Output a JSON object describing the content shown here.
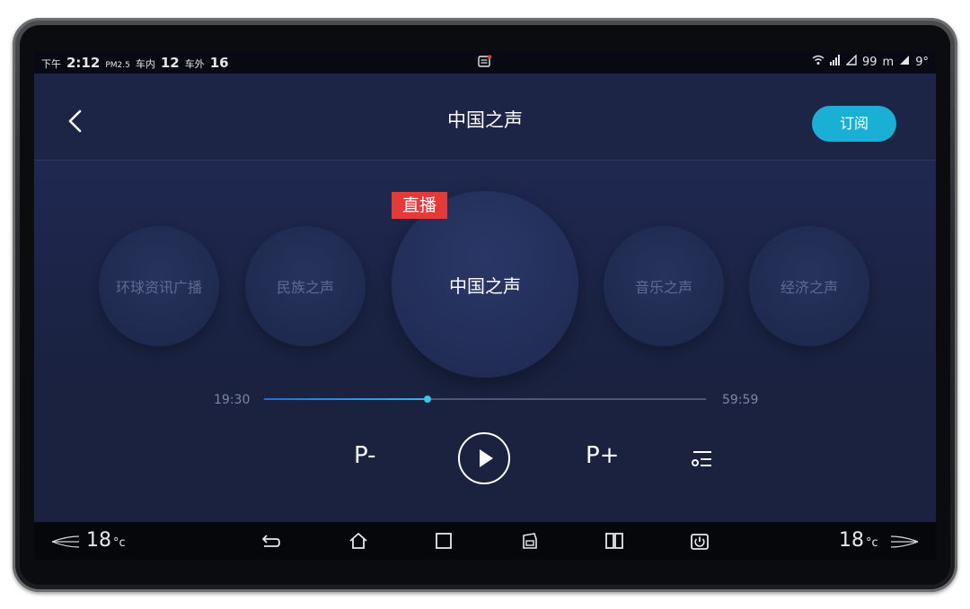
{
  "status_bar": {
    "ampm": "下午",
    "time": "2:12",
    "pm_label": "PM2.5",
    "inside_label": "车内",
    "inside_value": "12",
    "outside_label": "车外",
    "outside_value": "16",
    "network_value": "99",
    "network_unit": "m",
    "signal_value": "9°"
  },
  "header": {
    "title": "中国之声",
    "subscribe_label": "订阅"
  },
  "carousel": {
    "live_badge": "直播",
    "stations": [
      "环球资讯广播",
      "民族之声",
      "中国之声",
      "音乐之声",
      "经济之声"
    ],
    "selected_index": 2
  },
  "player": {
    "current_time": "19:30",
    "total_time": "59:59",
    "progress_fraction": 0.37,
    "prev_label": "P-",
    "next_label": "P+"
  },
  "nav_bar": {
    "left_temp": "18",
    "right_temp": "18",
    "temp_unit": "°c"
  },
  "colors": {
    "accent": "#1ab0d6",
    "live_red": "#e63a3a",
    "screen_bg": "#1a2240"
  }
}
